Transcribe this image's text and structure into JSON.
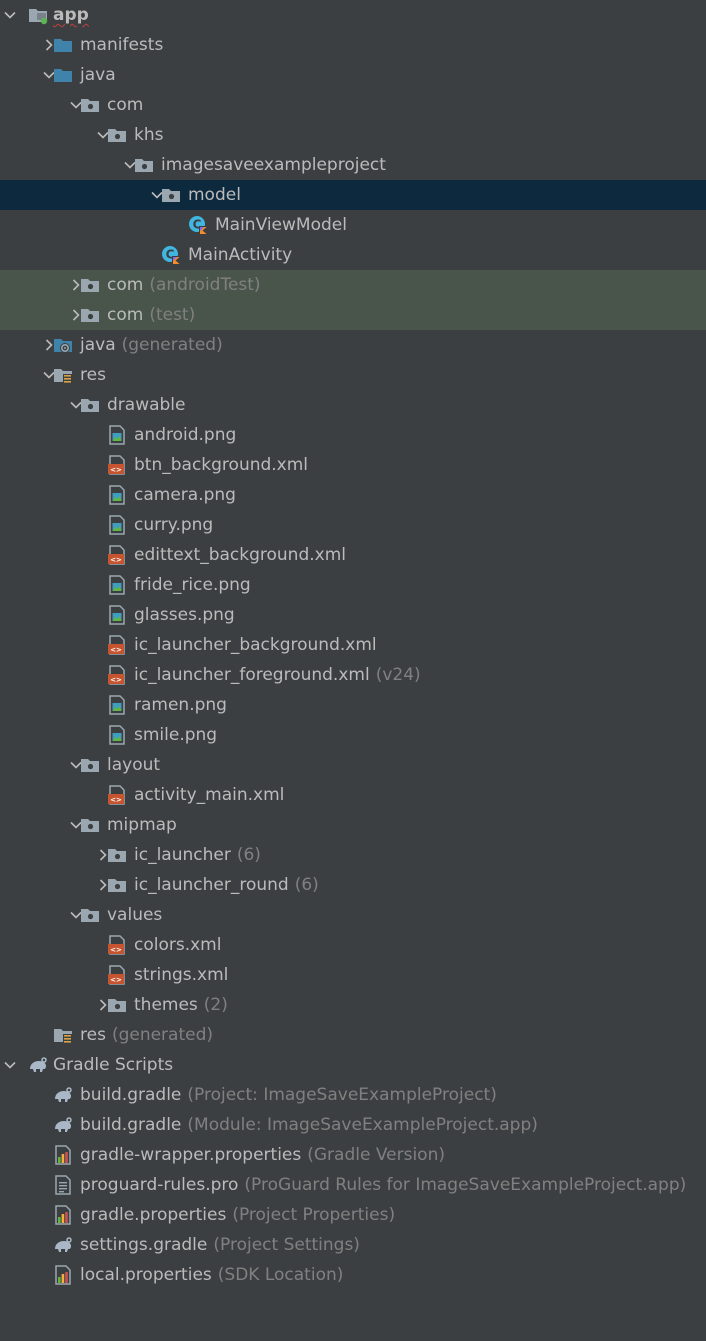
{
  "colors": {
    "background": "#3c3f41",
    "text": "#bbbbbb",
    "muted": "#808080",
    "selected_row": "#0d293e",
    "test_source_row": "#49544a",
    "source_folder": "#3f82aa",
    "folder": "#9aa7b0",
    "xml_icon": "#c75430",
    "gradle_icon": "#a9b7c6"
  },
  "tree": {
    "items": [
      {
        "label": "app",
        "extra": "",
        "level": 0,
        "expand": "open",
        "icon": "module-folder-icon",
        "bold": true,
        "underline": true,
        "row_style": ""
      },
      {
        "label": "manifests",
        "extra": "",
        "level": 1,
        "expand": "closed",
        "icon": "source-folder-icon",
        "row_style": ""
      },
      {
        "label": "java",
        "extra": "",
        "level": 1,
        "expand": "open",
        "icon": "source-folder-icon",
        "row_style": ""
      },
      {
        "label": "com",
        "extra": "",
        "level": 2,
        "expand": "open",
        "icon": "package-icon",
        "row_style": ""
      },
      {
        "label": "khs",
        "extra": "",
        "level": 3,
        "expand": "open",
        "icon": "package-icon",
        "row_style": ""
      },
      {
        "label": "imagesaveexampleproject",
        "extra": "",
        "level": 4,
        "expand": "open",
        "icon": "package-icon",
        "row_style": ""
      },
      {
        "label": "model",
        "extra": "",
        "level": 5,
        "expand": "open",
        "icon": "package-icon",
        "row_style": "selected"
      },
      {
        "label": "MainViewModel",
        "extra": "",
        "level": 6,
        "expand": "none",
        "icon": "kotlin-class-icon",
        "row_style": ""
      },
      {
        "label": "MainActivity",
        "extra": "",
        "level": 5,
        "expand": "none",
        "icon": "kotlin-class-icon",
        "row_style": ""
      },
      {
        "label": "com",
        "extra": "(androidTest)",
        "level": 2,
        "expand": "closed",
        "icon": "package-icon",
        "row_style": "testsrc"
      },
      {
        "label": "com",
        "extra": "(test)",
        "level": 2,
        "expand": "closed",
        "icon": "package-icon",
        "row_style": "testsrc"
      },
      {
        "label": "java",
        "extra": "(generated)",
        "level": 1,
        "expand": "closed",
        "icon": "generated-source-folder-icon",
        "row_style": ""
      },
      {
        "label": "res",
        "extra": "",
        "level": 1,
        "expand": "open",
        "icon": "resource-folder-icon",
        "row_style": ""
      },
      {
        "label": "drawable",
        "extra": "",
        "level": 2,
        "expand": "open",
        "icon": "package-icon",
        "row_style": ""
      },
      {
        "label": "android.png",
        "extra": "",
        "level": 3,
        "expand": "none",
        "icon": "image-file-icon",
        "row_style": ""
      },
      {
        "label": "btn_background.xml",
        "extra": "",
        "level": 3,
        "expand": "none",
        "icon": "xml-file-icon",
        "row_style": ""
      },
      {
        "label": "camera.png",
        "extra": "",
        "level": 3,
        "expand": "none",
        "icon": "image-file-icon",
        "row_style": ""
      },
      {
        "label": "curry.png",
        "extra": "",
        "level": 3,
        "expand": "none",
        "icon": "image-file-icon",
        "row_style": ""
      },
      {
        "label": "edittext_background.xml",
        "extra": "",
        "level": 3,
        "expand": "none",
        "icon": "xml-file-icon",
        "row_style": ""
      },
      {
        "label": "fride_rice.png",
        "extra": "",
        "level": 3,
        "expand": "none",
        "icon": "image-file-icon",
        "row_style": ""
      },
      {
        "label": "glasses.png",
        "extra": "",
        "level": 3,
        "expand": "none",
        "icon": "image-file-icon",
        "row_style": ""
      },
      {
        "label": "ic_launcher_background.xml",
        "extra": "",
        "level": 3,
        "expand": "none",
        "icon": "xml-file-icon",
        "row_style": ""
      },
      {
        "label": "ic_launcher_foreground.xml",
        "extra": "(v24)",
        "level": 3,
        "expand": "none",
        "icon": "xml-file-icon",
        "row_style": ""
      },
      {
        "label": "ramen.png",
        "extra": "",
        "level": 3,
        "expand": "none",
        "icon": "image-file-icon",
        "row_style": ""
      },
      {
        "label": "smile.png",
        "extra": "",
        "level": 3,
        "expand": "none",
        "icon": "image-file-icon",
        "row_style": ""
      },
      {
        "label": "layout",
        "extra": "",
        "level": 2,
        "expand": "open",
        "icon": "package-icon",
        "row_style": ""
      },
      {
        "label": "activity_main.xml",
        "extra": "",
        "level": 3,
        "expand": "none",
        "icon": "xml-file-icon",
        "row_style": ""
      },
      {
        "label": "mipmap",
        "extra": "",
        "level": 2,
        "expand": "open",
        "icon": "package-icon",
        "row_style": ""
      },
      {
        "label": "ic_launcher",
        "extra": "(6)",
        "level": 3,
        "expand": "closed",
        "icon": "package-icon",
        "row_style": ""
      },
      {
        "label": "ic_launcher_round",
        "extra": "(6)",
        "level": 3,
        "expand": "closed",
        "icon": "package-icon",
        "row_style": ""
      },
      {
        "label": "values",
        "extra": "",
        "level": 2,
        "expand": "open",
        "icon": "package-icon",
        "row_style": ""
      },
      {
        "label": "colors.xml",
        "extra": "",
        "level": 3,
        "expand": "none",
        "icon": "xml-file-icon",
        "row_style": ""
      },
      {
        "label": "strings.xml",
        "extra": "",
        "level": 3,
        "expand": "none",
        "icon": "xml-file-icon",
        "row_style": ""
      },
      {
        "label": "themes",
        "extra": "(2)",
        "level": 3,
        "expand": "closed",
        "icon": "package-icon",
        "row_style": ""
      },
      {
        "label": "res",
        "extra": "(generated)",
        "level": 1,
        "expand": "none",
        "icon": "resource-folder-icon",
        "row_style": ""
      },
      {
        "label": "Gradle Scripts",
        "extra": "",
        "level": 0,
        "expand": "open",
        "icon": "gradle-icon",
        "row_style": ""
      },
      {
        "label": "build.gradle",
        "extra": "(Project: ImageSaveExampleProject)",
        "level": 1,
        "expand": "none",
        "icon": "gradle-icon",
        "row_style": ""
      },
      {
        "label": "build.gradle",
        "extra": "(Module: ImageSaveExampleProject.app)",
        "level": 1,
        "expand": "none",
        "icon": "gradle-icon",
        "row_style": ""
      },
      {
        "label": "gradle-wrapper.properties",
        "extra": "(Gradle Version)",
        "level": 1,
        "expand": "none",
        "icon": "properties-file-icon",
        "row_style": ""
      },
      {
        "label": "proguard-rules.pro",
        "extra": "(ProGuard Rules for ImageSaveExampleProject.app)",
        "level": 1,
        "expand": "none",
        "icon": "text-file-icon",
        "row_style": ""
      },
      {
        "label": "gradle.properties",
        "extra": "(Project Properties)",
        "level": 1,
        "expand": "none",
        "icon": "properties-file-icon",
        "row_style": ""
      },
      {
        "label": "settings.gradle",
        "extra": "(Project Settings)",
        "level": 1,
        "expand": "none",
        "icon": "gradle-icon",
        "row_style": ""
      },
      {
        "label": "local.properties",
        "extra": "(SDK Location)",
        "level": 1,
        "expand": "none",
        "icon": "properties-file-icon",
        "row_style": ""
      }
    ]
  }
}
